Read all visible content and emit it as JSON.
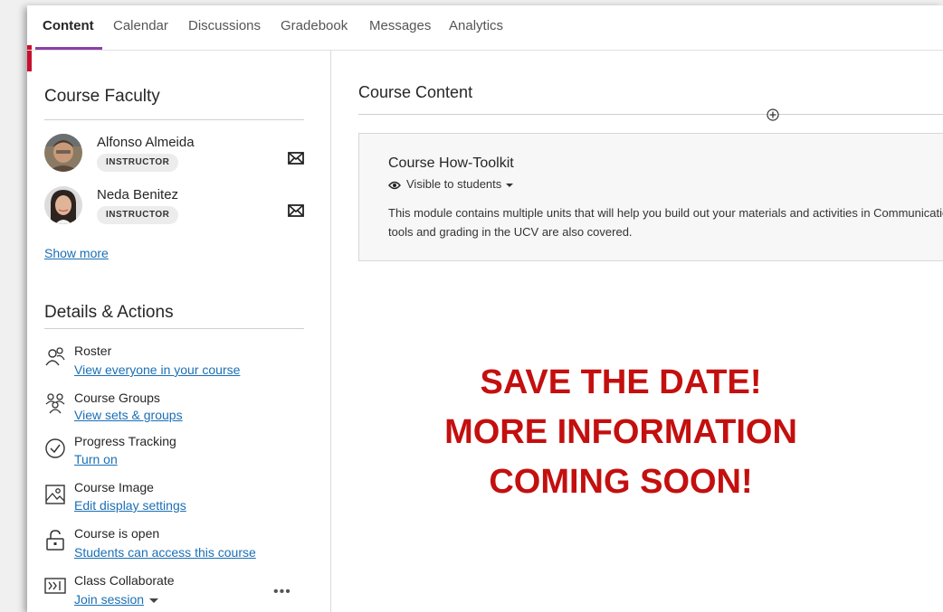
{
  "nav": {
    "tabs": [
      "Content",
      "Calendar",
      "Discussions",
      "Gradebook",
      "Messages",
      "Analytics"
    ],
    "active": "Content"
  },
  "faculty": {
    "title": "Course Faculty",
    "members": [
      {
        "name": "Alfonso Almeida",
        "role": "INSTRUCTOR"
      },
      {
        "name": "Neda Benitez",
        "role": "INSTRUCTOR"
      }
    ],
    "show_more": "Show more"
  },
  "details": {
    "title": "Details & Actions",
    "items": [
      {
        "title": "Roster",
        "link": "View everyone in your course",
        "icon": "roster-icon"
      },
      {
        "title": "Course Groups",
        "link": "View sets & groups",
        "icon": "groups-icon"
      },
      {
        "title": "Progress Tracking",
        "link": "Turn on",
        "icon": "check-circle-icon"
      },
      {
        "title": "Course Image",
        "link": "Edit display settings",
        "icon": "image-icon"
      },
      {
        "title": "Course is open",
        "link": "Students can access this course",
        "icon": "unlock-icon"
      },
      {
        "title": "Class Collaborate",
        "link": "Join session",
        "icon": "collaborate-icon"
      }
    ],
    "more_label": "•••"
  },
  "content": {
    "title": "Course Content",
    "card": {
      "title": "Course How-Toolkit",
      "visibility": "Visible to students",
      "description": "This module contains multiple units that will help you build out your materials and activities in Communication tools and grading in the UCV are also covered."
    },
    "announcement": [
      "SAVE THE DATE!",
      "MORE INFORMATION",
      "COMING SOON!"
    ]
  },
  "colors": {
    "accent": "#c8102e",
    "tab_underline": "#8b3fa8",
    "link": "#1a6fb5",
    "announcement": "#c40f0f"
  }
}
